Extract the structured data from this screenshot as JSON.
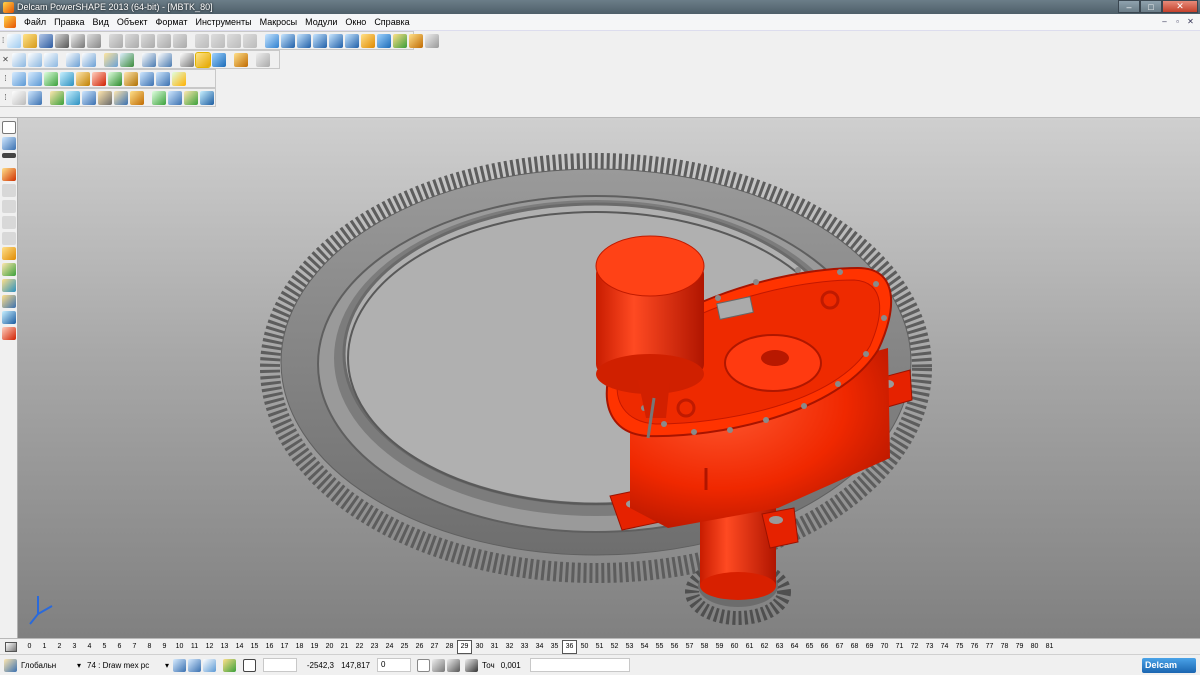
{
  "window": {
    "title": "Delcam PowerSHAPE 2013 (64-bit) - [MBTK_80]",
    "minimize": "–",
    "maximize": "□",
    "close": "✕"
  },
  "menu": [
    "Файл",
    "Правка",
    "Вид",
    "Объект",
    "Формат",
    "Инструменты",
    "Макросы",
    "Модули",
    "Окно",
    "Справка"
  ],
  "mdi": {
    "minimize": "–",
    "restore": "▫",
    "close": "✕"
  },
  "layers": {
    "numbers": [
      "0",
      "1",
      "2",
      "3",
      "4",
      "5",
      "6",
      "7",
      "8",
      "9",
      "10",
      "11",
      "12",
      "13",
      "14",
      "15",
      "16",
      "17",
      "18",
      "19",
      "20",
      "21",
      "22",
      "23",
      "24",
      "25",
      "26",
      "27",
      "28",
      "29",
      "30",
      "31",
      "32",
      "33",
      "34",
      "35",
      "36",
      "50",
      "51",
      "52",
      "53",
      "54",
      "55",
      "56",
      "57",
      "58",
      "59",
      "60",
      "61",
      "62",
      "63",
      "64",
      "65",
      "66",
      "67",
      "68",
      "69",
      "70",
      "71",
      "72",
      "73",
      "74",
      "75",
      "76",
      "77",
      "78",
      "79",
      "80",
      "81"
    ],
    "boxed": [
      "29",
      "36"
    ]
  },
  "status": {
    "workplane": "Глобальн",
    "layer": "74 : Draw mex pc",
    "x": "-2542,3",
    "y": "147,817",
    "z": "0",
    "tolerance_label": "Точ",
    "tolerance": "0,001",
    "logo": "Delcam"
  },
  "colors": {
    "part_red": "#ff2200",
    "gear_gray": "#8a8a8a",
    "viewport_top": "#cfcfcf",
    "viewport_bottom": "#808080"
  }
}
